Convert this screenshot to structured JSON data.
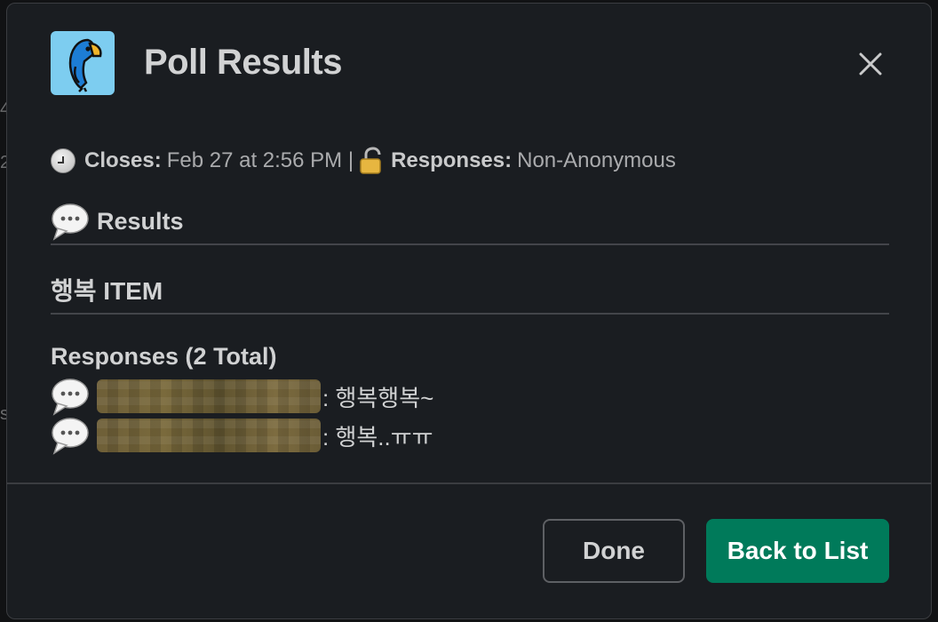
{
  "modal": {
    "title": "Poll Results",
    "close_icon": "close-icon",
    "app_icon": "parrot-app-icon"
  },
  "meta": {
    "closes_label": "Closes:",
    "closes_value": "Feb 27 at 2:56 PM |",
    "responses_label": "Responses:",
    "responses_value": "Non-Anonymous"
  },
  "results": {
    "heading": "Results",
    "item_title": "행복 ITEM",
    "responses_title": "Responses (2 Total)",
    "responses": [
      {
        "user": "",
        "text": ": 행복행복~"
      },
      {
        "user": "",
        "text": ": 행복..ㅠㅠ"
      }
    ]
  },
  "footer": {
    "done_label": "Done",
    "back_label": "Back to List",
    "back_color": "#007a5a"
  },
  "background": {
    "glyph_1": "4",
    "glyph_2": "2",
    "glyph_3": "s"
  }
}
